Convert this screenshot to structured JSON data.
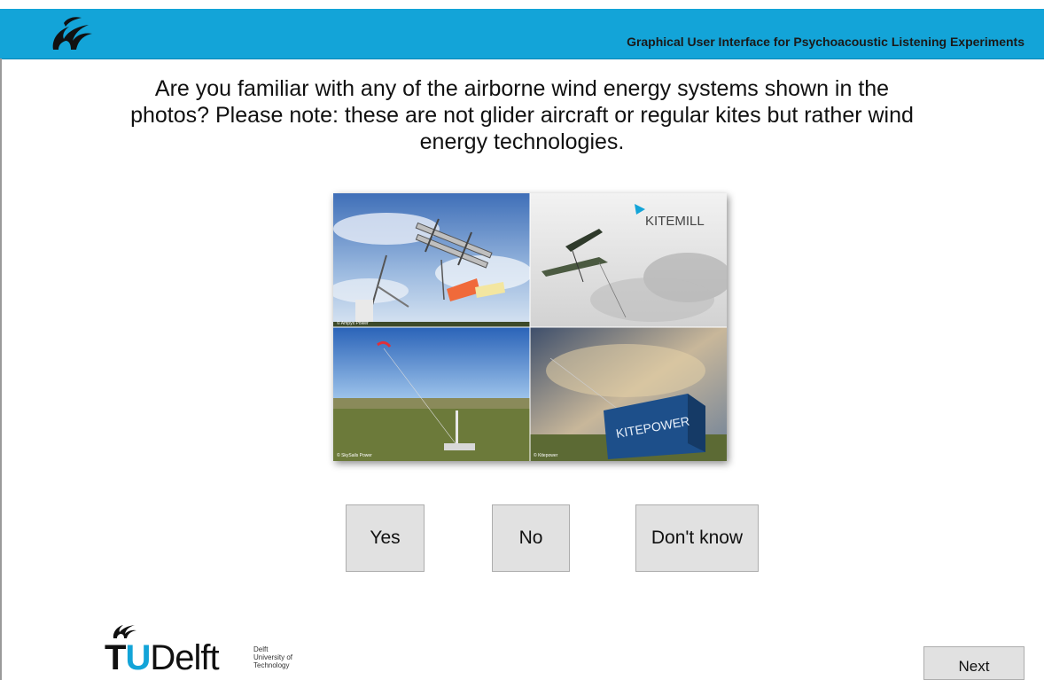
{
  "header": {
    "title": "Graphical User Interface for Psychoacoustic Listening Experiments",
    "logo_icon": "tudelft-flame-icon",
    "bg_color": "#13a4d8"
  },
  "question": {
    "text": "Are you familiar with any of the airborne wind energy systems shown in the photos? Please note: these are not glider aircraft or regular kites but rather wind energy technologies."
  },
  "photos": {
    "tiles": [
      {
        "credit": "© Ampyx Power"
      },
      {
        "logo_text": "KITEMILL"
      },
      {
        "credit": "© SkySails Power"
      },
      {
        "credit": "© Kitepower",
        "container_text": "KITEPOWER"
      }
    ]
  },
  "answers": {
    "yes_label": "Yes",
    "no_label": "No",
    "dont_know_label": "Don't know"
  },
  "footer": {
    "logo_t": "T",
    "logo_u": "U",
    "logo_word": "Delft",
    "logo_sub1": "Delft",
    "logo_sub2": "University of",
    "logo_sub3": "Technology",
    "next_label": "Next"
  }
}
